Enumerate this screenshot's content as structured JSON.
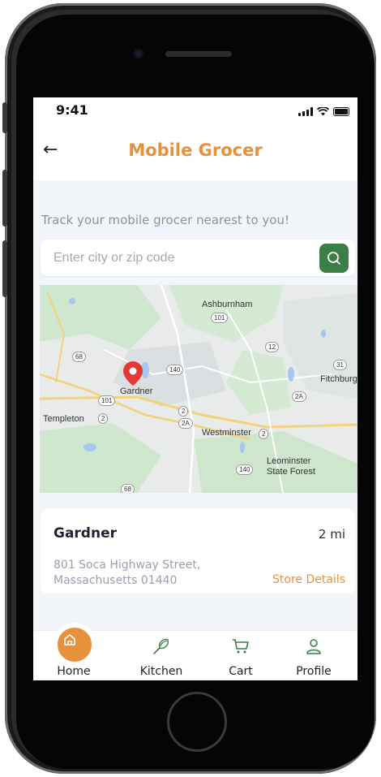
{
  "status_bar": {
    "time": "9:41"
  },
  "header": {
    "title": "Mobile Grocer",
    "back_icon": "arrow-left-icon"
  },
  "tagline": "Track your mobile grocer nearest to you!",
  "search": {
    "placeholder": "Enter city or zip code",
    "value": "",
    "button_icon": "search-icon"
  },
  "map": {
    "labels": [
      "Ashburnham",
      "Gardner",
      "Templeton",
      "Westminster",
      "Leominster",
      "State Forest",
      "Fitchburg"
    ],
    "route_shields": [
      "101",
      "68",
      "12",
      "140",
      "31",
      "101",
      "2",
      "2",
      "2A",
      "2A",
      "2",
      "140",
      "68"
    ]
  },
  "store_card": {
    "city": "Gardner",
    "distance": "2 mi",
    "address_line1": "801 Soca Highway Street,",
    "address_line2": "Massachusetts 01440",
    "details_link": "Store Details"
  },
  "bottom_nav": {
    "items": [
      {
        "label": "Home",
        "icon": "home-icon",
        "active": true
      },
      {
        "label": "Kitchen",
        "icon": "whisk-icon",
        "active": false
      },
      {
        "label": "Cart",
        "icon": "cart-icon",
        "active": false
      },
      {
        "label": "Profile",
        "icon": "user-icon",
        "active": false
      }
    ]
  },
  "colors": {
    "accent": "#e8913c",
    "brand_green": "#3a7f46",
    "background": "#f2f5fa"
  }
}
